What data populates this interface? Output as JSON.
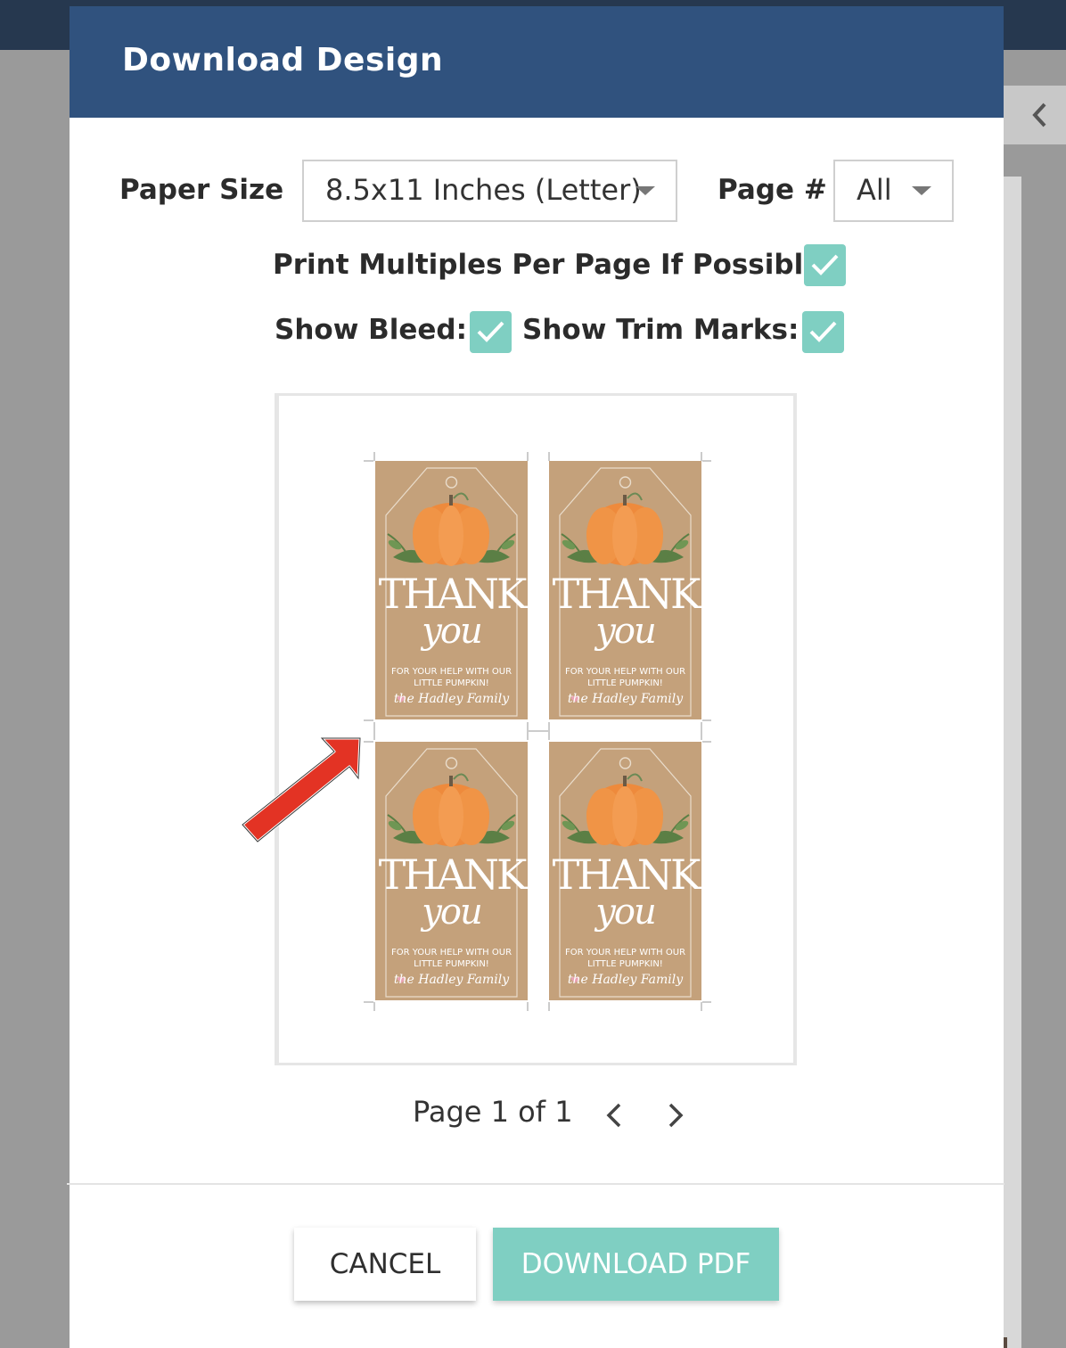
{
  "modal": {
    "title": "Download Design"
  },
  "options": {
    "paper_size_label": "Paper Size",
    "paper_size_value": "8.5x11 Inches (Letter)",
    "page_label": "Page #",
    "page_value": "All",
    "print_multiples_label": "Print Multiples Per Page If Possible:",
    "print_multiples_checked": true,
    "show_bleed_label": "Show Bleed:",
    "show_bleed_checked": true,
    "show_trim_label": "Show Trim Marks:",
    "show_trim_checked": true
  },
  "preview": {
    "tag": {
      "thank": "THANK",
      "you": "you",
      "line1": "FOR YOUR HELP WITH OUR",
      "line2": "LITTLE PUMPKIN!",
      "family": "the Hadley Family"
    }
  },
  "pager": {
    "text": "Page 1 of 1"
  },
  "footer": {
    "cancel_label": "CANCEL",
    "download_label": "DOWNLOAD PDF"
  },
  "colors": {
    "header": "#30527e",
    "accent": "#7fcfc2",
    "kraft": "#c4a17b",
    "pumpkin": "#ee8a3c",
    "arrow": "#e33324"
  },
  "icons": [
    "chevron-left-icon",
    "chevron-right-icon",
    "caret-down-icon",
    "checkmark-icon",
    "red-arrow-icon"
  ]
}
